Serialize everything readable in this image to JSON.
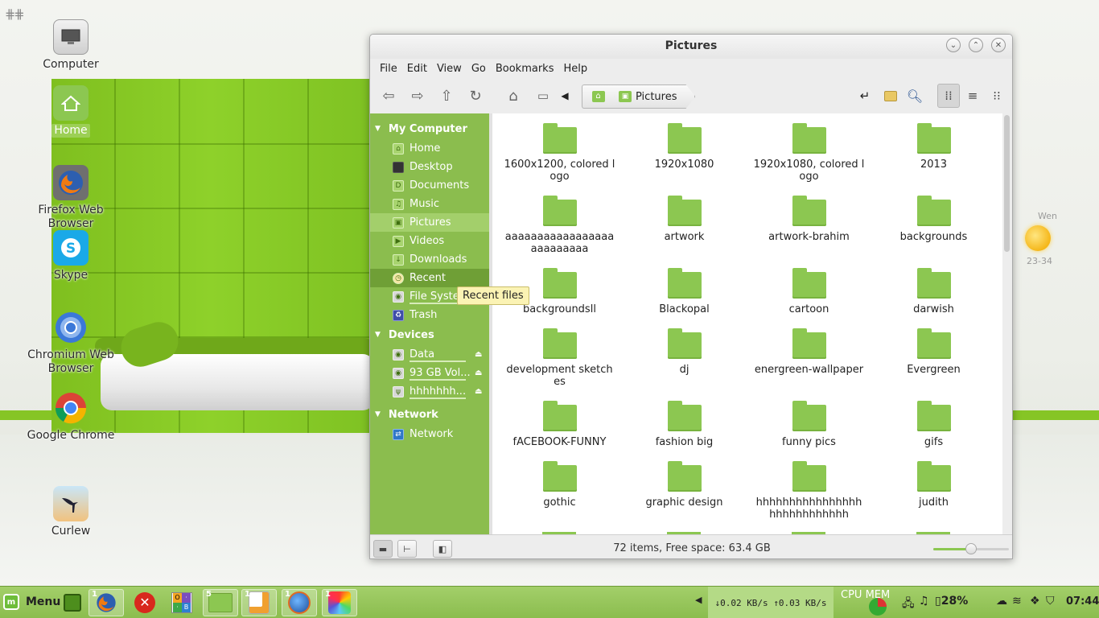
{
  "window": {
    "title": "Pictures",
    "menu": [
      "File",
      "Edit",
      "View",
      "Go",
      "Bookmarks",
      "Help"
    ],
    "breadcrumb": {
      "current": "Pictures"
    }
  },
  "desktop_icons": [
    {
      "label": "Computer"
    },
    {
      "label": "Home"
    },
    {
      "label": "Firefox Web Browser"
    },
    {
      "label": "Skype"
    },
    {
      "label": "Chromium Web Browser"
    },
    {
      "label": "Google Chrome"
    },
    {
      "label": "Curlew"
    }
  ],
  "sidebar": {
    "sections": [
      {
        "title": "My Computer",
        "items": [
          "Home",
          "Desktop",
          "Documents",
          "Music",
          "Pictures",
          "Videos",
          "Downloads",
          "Recent",
          "File System",
          "Trash"
        ]
      },
      {
        "title": "Devices",
        "items": [
          "Data",
          "93 GB Vol...",
          "hhhhhhh..."
        ]
      },
      {
        "title": "Network",
        "items": [
          "Network"
        ]
      }
    ],
    "active": "Pictures",
    "tooltip": "Recent files"
  },
  "folders": [
    "1600x1200, colored logo",
    "1920x1080",
    "1920x1080, colored logo",
    "2013",
    "aaaaaaaaaaaaaaaaaaaaaaaaaa",
    "artwork",
    "artwork-brahim",
    "backgrounds",
    "backgroundsll",
    "Blackopal",
    "cartoon",
    "darwish",
    "development sketches",
    "dj",
    "energreen-wallpaper",
    "Evergreen",
    "fACEBOOK-FUNNY",
    "fashion big",
    "funny pics",
    "gifs",
    "gothic",
    "graphic design",
    "hhhhhhhhhhhhhhhhhhhhhhhhhhhh",
    "judith"
  ],
  "status": {
    "text": "72 items, Free space: 63.4 GB",
    "zoom_fraction": 0.5
  },
  "weather": {
    "day": "Wen",
    "temp": "23-34"
  },
  "taskbar": {
    "menu_label": "Menu",
    "counts": [
      "1",
      "1",
      "5",
      "1",
      "1",
      "1"
    ],
    "net_down": "↓0.02 KB/s",
    "net_up": "↑0.03 KB/s",
    "cpumem": "CPU MEM",
    "battery": "28%",
    "clock": "07:44"
  }
}
